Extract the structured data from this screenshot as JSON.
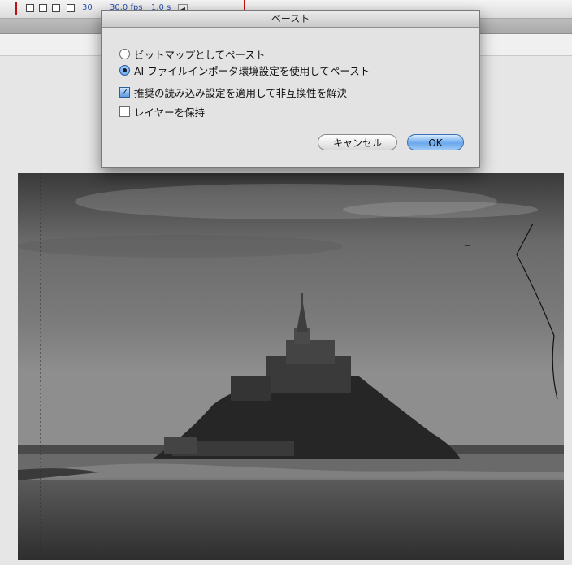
{
  "toolbar": {
    "frame_value": "30",
    "fps_label": "30.0 fps",
    "scale_label": "1.0 s",
    "arrow": "◀"
  },
  "dialog": {
    "title": "ペースト",
    "radio_bitmap": "ビットマップとしてペースト",
    "radio_ai_prefs": "AI ファイルインポータ環境設定を使用してペースト",
    "radio_selected": "radio_ai_prefs",
    "check_recommended": "推奨の読み込み設定を適用して非互換性を解決",
    "check_recommended_checked": true,
    "check_keep_layers": "レイヤーを保持",
    "check_keep_layers_checked": false,
    "check_mark": "✓",
    "cancel_label": "キャンセル",
    "ok_label": "OK"
  },
  "colors": {
    "accent": "#4a8fdc",
    "dialog_bg": "#e3e3e3"
  }
}
